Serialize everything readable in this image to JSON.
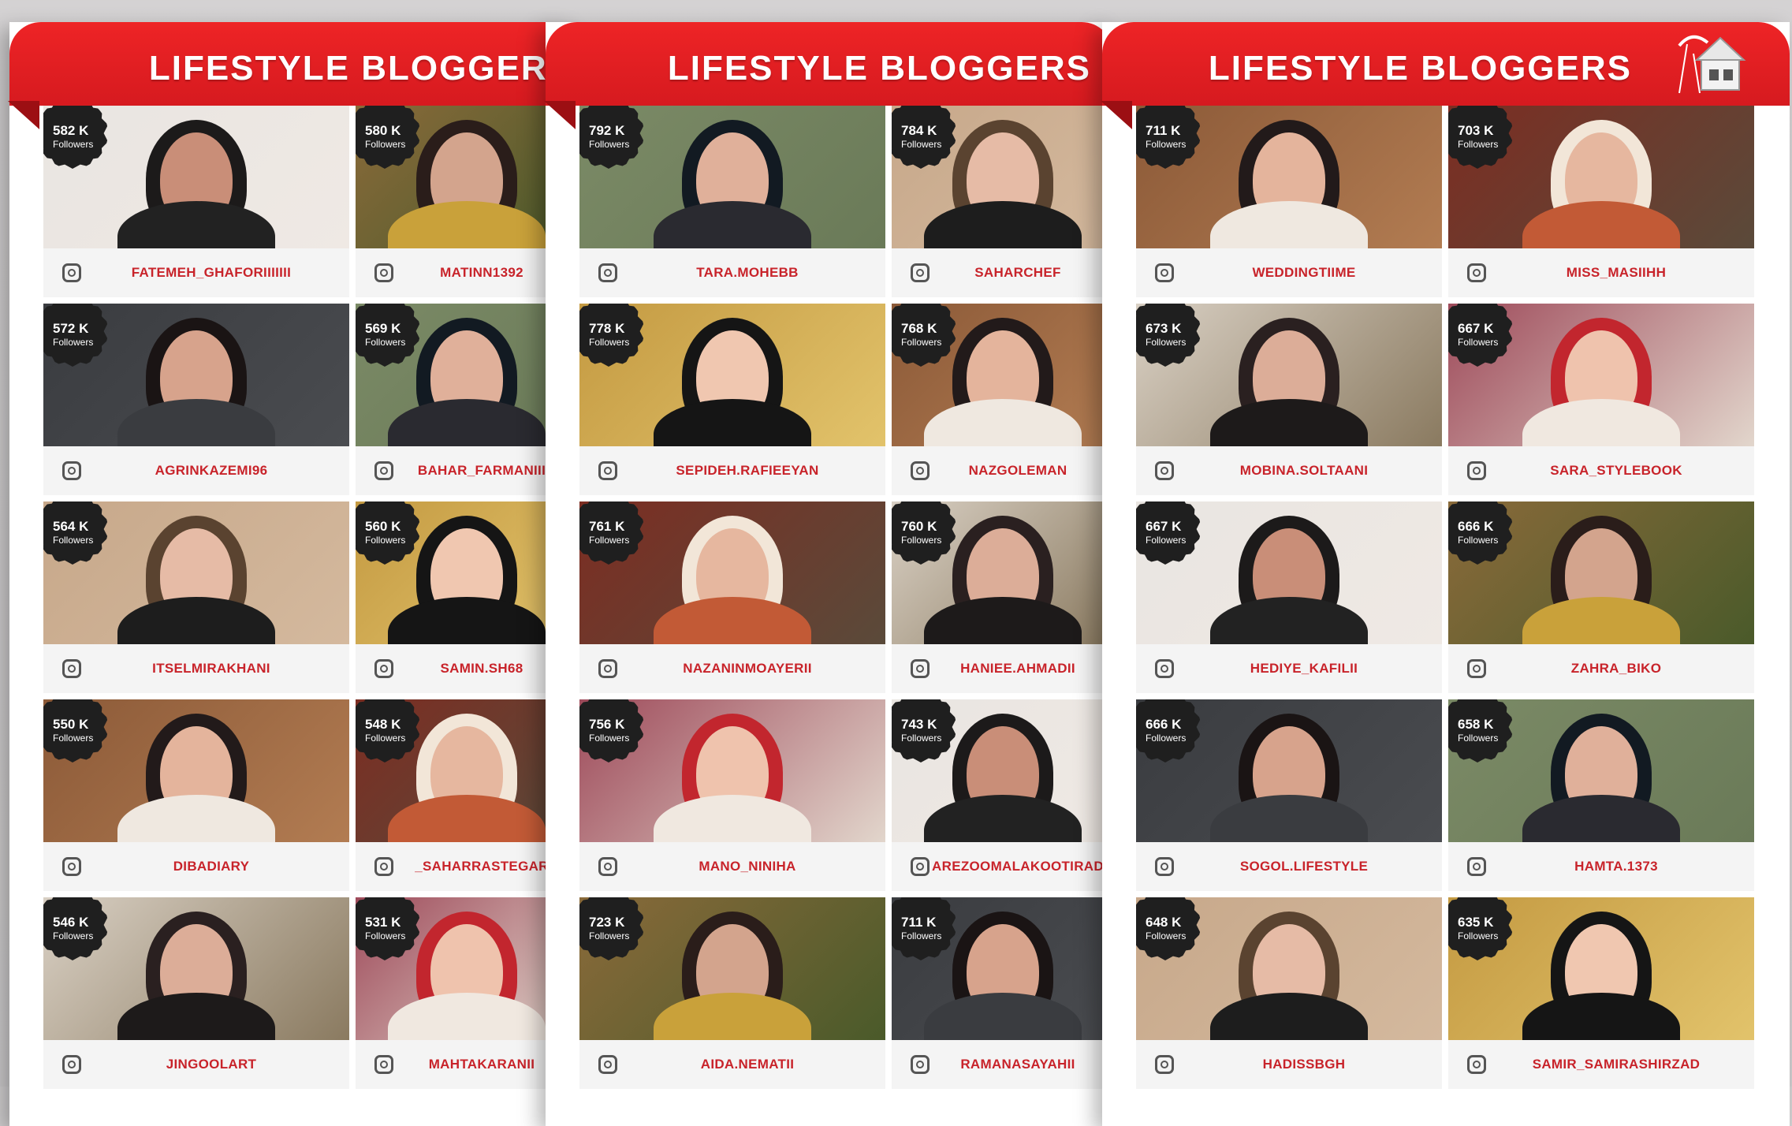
{
  "banner_title": "LIFESTYLE BLOGGERS",
  "followers_label": "Followers",
  "colors": {
    "banner": "#e0201f",
    "handle": "#c8232a",
    "badge": "#1f1f1f"
  },
  "sheets": [
    {
      "cards": [
        {
          "count": "582 K",
          "handle": "FATEMEH_GHAFORIIIIIII"
        },
        {
          "count": "580 K",
          "handle": "MATINN1392"
        },
        {
          "count": "572 K",
          "handle": "AGRINKAZEMI96"
        },
        {
          "count": "569 K",
          "handle": "BAHAR_FARMANIII"
        },
        {
          "count": "564 K",
          "handle": "ITSELMIRAKHANI"
        },
        {
          "count": "560 K",
          "handle": "SAMIN.SH68"
        },
        {
          "count": "550 K",
          "handle": "DIBADIARY"
        },
        {
          "count": "548 K",
          "handle": "_SAHARRASTEGAR"
        },
        {
          "count": "546 K",
          "handle": "JINGOOLART"
        },
        {
          "count": "531 K",
          "handle": "MAHTAKARANII"
        }
      ]
    },
    {
      "cards": [
        {
          "count": "792 K",
          "handle": "TARA.MOHEBB"
        },
        {
          "count": "784 K",
          "handle": "SAHARCHEF"
        },
        {
          "count": "778 K",
          "handle": "SEPIDEH.RAFIEEYAN"
        },
        {
          "count": "768 K",
          "handle": "NAZGOLEMAN"
        },
        {
          "count": "761 K",
          "handle": "NAZANINMOAYERII"
        },
        {
          "count": "760 K",
          "handle": "HANIEE.AHMADII"
        },
        {
          "count": "756 K",
          "handle": "MANO_NINIHA"
        },
        {
          "count": "743 K",
          "handle": "AREZOOMALAKOOTIRAD"
        },
        {
          "count": "723 K",
          "handle": "AIDA.NEMATII"
        },
        {
          "count": "711 K",
          "handle": "RAMANASAYAHII"
        }
      ]
    },
    {
      "cards": [
        {
          "count": "711 K",
          "handle": "WEDDINGTIIME"
        },
        {
          "count": "703 K",
          "handle": "MISS_MASIIHH"
        },
        {
          "count": "673 K",
          "handle": "MOBINA.SOLTAANI"
        },
        {
          "count": "667 K",
          "handle": "SARA_STYLEBOOK"
        },
        {
          "count": "667 K",
          "handle": "HEDIYE_KAFILII"
        },
        {
          "count": "666 K",
          "handle": "ZAHRA_BIKO"
        },
        {
          "count": "666 K",
          "handle": "SOGOL.LIFESTYLE"
        },
        {
          "count": "658 K",
          "handle": "HAMTA.1373"
        },
        {
          "count": "648 K",
          "handle": "HADISSBGH"
        },
        {
          "count": "635 K",
          "handle": "SAMIR_SAMIRASHIRZAD"
        }
      ]
    }
  ]
}
